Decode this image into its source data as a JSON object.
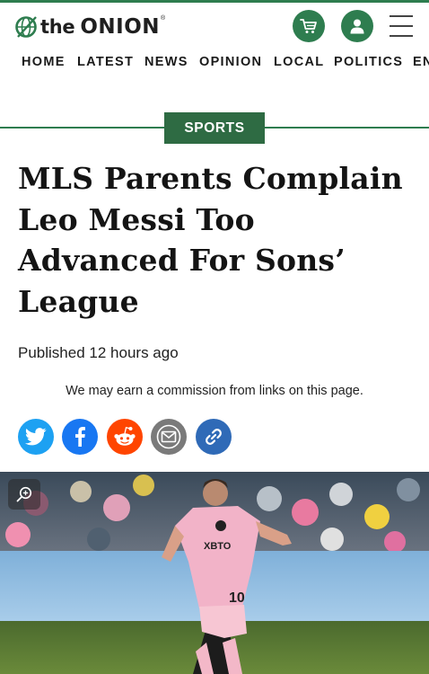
{
  "brand": {
    "the": "the",
    "onion": "ONION",
    "registered": "®",
    "accent_color": "#2e7d4f"
  },
  "header": {
    "icons": [
      "globe-logo-icon",
      "cart-icon",
      "account-icon",
      "hamburger-menu-icon"
    ]
  },
  "nav": {
    "items": [
      {
        "label": "HOME"
      },
      {
        "label": "LATEST"
      },
      {
        "label": "NEWS"
      },
      {
        "label": "OPINION"
      },
      {
        "label": "LOCAL"
      },
      {
        "label": "POLITICS"
      },
      {
        "label": "EN"
      }
    ]
  },
  "article": {
    "section": "SPORTS",
    "headline_lines": [
      "MLS Parents Complain",
      "Leo Messi Too",
      "Advanced For Sons’",
      "League"
    ],
    "published_label": "Published",
    "published_time": "12 hours ago",
    "disclaimer": "We may earn a commission from links on this page."
  },
  "share": {
    "buttons": [
      {
        "name": "twitter",
        "icon": "twitter-bird-icon",
        "color": "#1da1f2"
      },
      {
        "name": "facebook",
        "icon": "facebook-f-icon",
        "color": "#1877f2"
      },
      {
        "name": "reddit",
        "icon": "reddit-alien-icon",
        "color": "#ff4500"
      },
      {
        "name": "email",
        "icon": "envelope-icon",
        "color": "#7a7a7a"
      },
      {
        "name": "copy-link",
        "icon": "chain-link-icon",
        "color": "#2f6ab7"
      }
    ]
  },
  "hero": {
    "jersey_text": "XBTO",
    "jersey_number": "10",
    "zoom_icon": "zoom-in-icon"
  }
}
